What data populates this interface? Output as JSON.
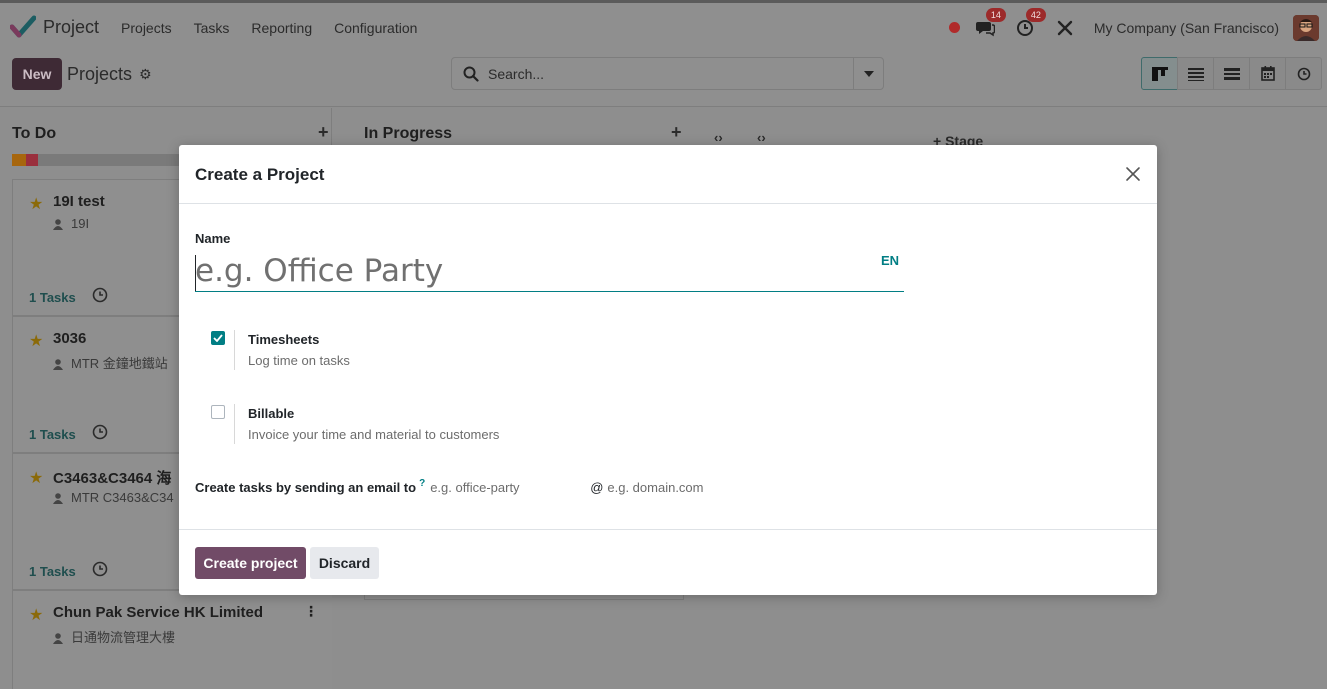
{
  "navbar": {
    "app_name": "Project",
    "menu": [
      "Projects",
      "Tasks",
      "Reporting",
      "Configuration"
    ],
    "messages_count": "14",
    "activities_count": "42",
    "company": "My Company (San Francisco)"
  },
  "control_panel": {
    "new_label": "New",
    "breadcrumb": "Projects",
    "search_placeholder": "Search...",
    "views": [
      "kanban-icon",
      "list-icon",
      "list-detailed-icon",
      "calendar-icon",
      "activity-clock-icon"
    ]
  },
  "kanban": {
    "columns": [
      {
        "title": "To Do"
      },
      {
        "title": "In Progress"
      }
    ],
    "add_stage_label": "Stage",
    "cards": [
      {
        "name": "19I test",
        "person": "19I",
        "tasks": "1 Tasks"
      },
      {
        "name": "3036",
        "person": "MTR 金鐘地鐵站",
        "tasks": "1 Tasks"
      },
      {
        "name": "C3463&C3464 海",
        "person": "MTR C3463&C34",
        "tasks": "1 Tasks"
      },
      {
        "name": "Chun Pak Service HK Limited",
        "person": "日通物流管理大樓",
        "tasks": ""
      }
    ]
  },
  "dialog": {
    "title": "Create a Project",
    "name_label": "Name",
    "name_placeholder": "e.g. Office Party",
    "lang": "EN",
    "options": [
      {
        "title": "Timesheets",
        "description": "Log time on tasks",
        "checked": true
      },
      {
        "title": "Billable",
        "description": "Invoice your time and material to customers",
        "checked": false
      }
    ],
    "email_label": "Create tasks by sending an email to",
    "email_help": "?",
    "email_alias_placeholder": "e.g. office-party",
    "email_at": "@",
    "email_domain_placeholder": "e.g. domain.com",
    "create_label": "Create project",
    "discard_label": "Discard"
  },
  "colors": {
    "primary": "#714b67",
    "accent": "#017e84",
    "overlay_bg": "#8e8e8e"
  }
}
